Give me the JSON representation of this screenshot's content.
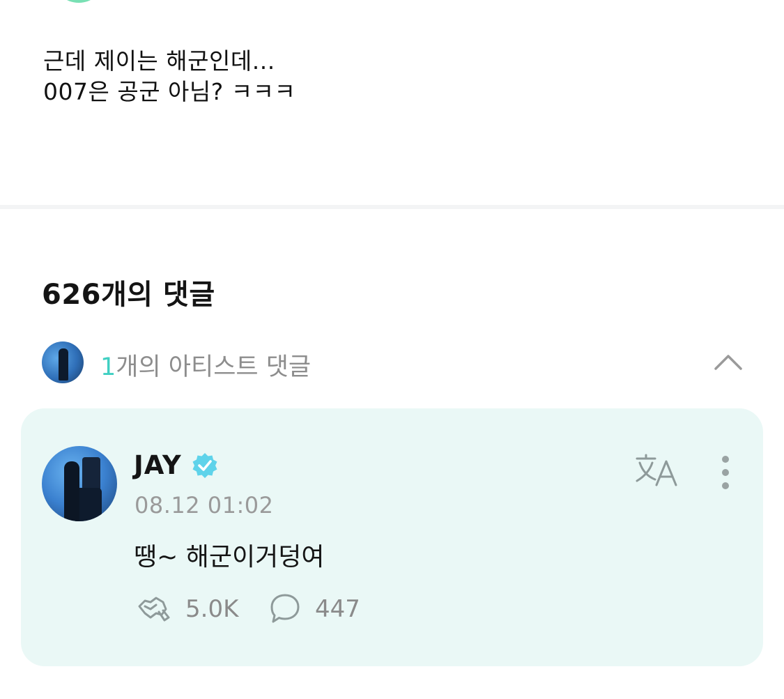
{
  "post": {
    "lines": [
      "근데 제이는 해군인데...",
      "007은 공군 아님? ㅋㅋㅋ"
    ]
  },
  "comments": {
    "total_label": "626개의 댓글",
    "artist_section": {
      "count": "1",
      "label": "개의 아티스트 댓글"
    },
    "items": [
      {
        "author": "JAY",
        "verified": true,
        "timestamp": "08.12 01:02",
        "text": "땡~ 해군이거덩여",
        "likes": "5.0K",
        "replies": "447"
      }
    ]
  },
  "colors": {
    "accent": "#3fcfc2",
    "card_background": "#eaf8f6",
    "muted_text": "#8d8d8d"
  },
  "icons": {
    "verified": "verified-badge-icon",
    "translate": "translate-icon",
    "more": "more-vertical-icon",
    "like": "like-icon",
    "reply": "reply-bubble-icon",
    "collapse": "chevron-up-icon"
  }
}
